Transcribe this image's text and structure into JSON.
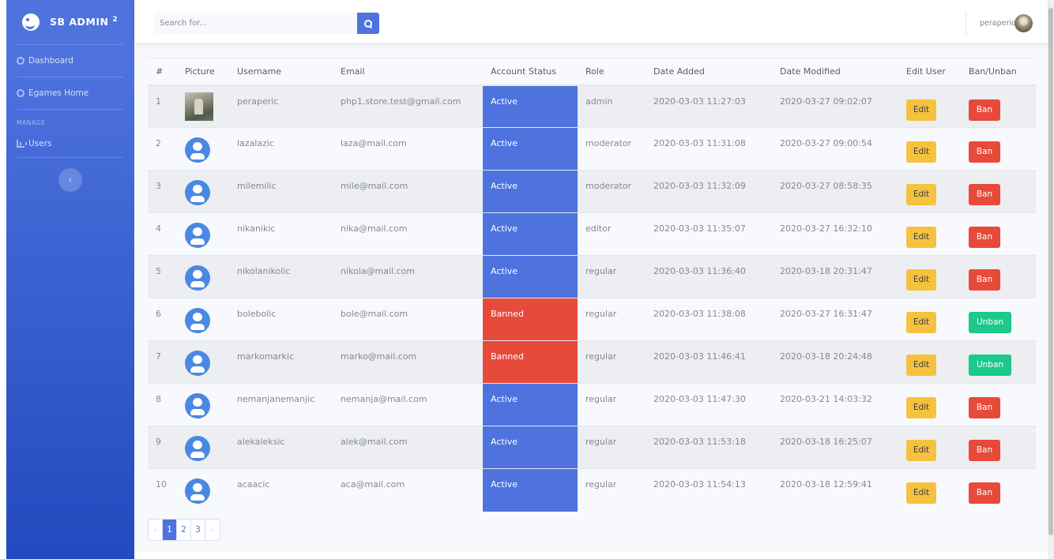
{
  "brand": {
    "name": "SB ADMIN",
    "sup": "2"
  },
  "sidebar": {
    "items": [
      {
        "label": "Dashboard",
        "icon": "tachometer-icon"
      },
      {
        "label": "Egames Home",
        "icon": "tachometer-icon"
      }
    ],
    "heading": "MANAGE",
    "manage_items": [
      {
        "label": "Users",
        "icon": "chart-area-icon"
      }
    ]
  },
  "search": {
    "placeholder": "Search for..."
  },
  "topbar": {
    "user_name": "peraperic"
  },
  "table": {
    "columns": [
      "#",
      "Picture",
      "Username",
      "Email",
      "Account Status",
      "Role",
      "Date Added",
      "Date Modified",
      "Edit User",
      "Ban/Unban"
    ],
    "rows": [
      {
        "num": "1",
        "username": "peraperic",
        "email": "php1.store.test@gmail.com",
        "status": "Active",
        "role": "admin",
        "added": "2020-03-03 11:27:03",
        "modified": "2020-03-27 09:02:07",
        "edit": "Edit",
        "action": "Ban"
      },
      {
        "num": "2",
        "username": "lazalazic",
        "email": "laza@mail.com",
        "status": "Active",
        "role": "moderator",
        "added": "2020-03-03 11:31:08",
        "modified": "2020-03-27 09:00:54",
        "edit": "Edit",
        "action": "Ban"
      },
      {
        "num": "3",
        "username": "milemilic",
        "email": "mile@mail.com",
        "status": "Active",
        "role": "moderator",
        "added": "2020-03-03 11:32:09",
        "modified": "2020-03-27 08:58:35",
        "edit": "Edit",
        "action": "Ban"
      },
      {
        "num": "4",
        "username": "nikanikic",
        "email": "nika@mail.com",
        "status": "Active",
        "role": "editor",
        "added": "2020-03-03 11:35:07",
        "modified": "2020-03-27 16:32:10",
        "edit": "Edit",
        "action": "Ban"
      },
      {
        "num": "5",
        "username": "nikolanikolic",
        "email": "nikola@mail.com",
        "status": "Active",
        "role": "regular",
        "added": "2020-03-03 11:36:40",
        "modified": "2020-03-18 20:31:47",
        "edit": "Edit",
        "action": "Ban"
      },
      {
        "num": "6",
        "username": "bolebolic",
        "email": "bole@mail.com",
        "status": "Banned",
        "role": "regular",
        "added": "2020-03-03 11:38:08",
        "modified": "2020-03-27 16:31:47",
        "edit": "Edit",
        "action": "Unban"
      },
      {
        "num": "7",
        "username": "markomarkic",
        "email": "marko@mail.com",
        "status": "Banned",
        "role": "regular",
        "added": "2020-03-03 11:46:41",
        "modified": "2020-03-18 20:24:48",
        "edit": "Edit",
        "action": "Unban"
      },
      {
        "num": "8",
        "username": "nemanjanemanjic",
        "email": "nemanja@mail.com",
        "status": "Active",
        "role": "regular",
        "added": "2020-03-03 11:47:30",
        "modified": "2020-03-21 14:03:32",
        "edit": "Edit",
        "action": "Ban"
      },
      {
        "num": "9",
        "username": "alekaleksic",
        "email": "alek@mail.com",
        "status": "Active",
        "role": "regular",
        "added": "2020-03-03 11:53:18",
        "modified": "2020-03-18 16:25:07",
        "edit": "Edit",
        "action": "Ban"
      },
      {
        "num": "10",
        "username": "acaacic",
        "email": "aca@mail.com",
        "status": "Active",
        "role": "regular",
        "added": "2020-03-03 11:54:13",
        "modified": "2020-03-18 12:59:41",
        "edit": "Edit",
        "action": "Ban"
      }
    ]
  },
  "pagination": {
    "prev": "‹",
    "pages": [
      "1",
      "2",
      "3"
    ],
    "next": "›",
    "current": "1"
  },
  "colors": {
    "primary": "#4e73df",
    "active": "#4e73df",
    "banned": "#e74a3b",
    "edit": "#f6c23e",
    "ban": "#e74a3b",
    "unban": "#1cc88a"
  }
}
